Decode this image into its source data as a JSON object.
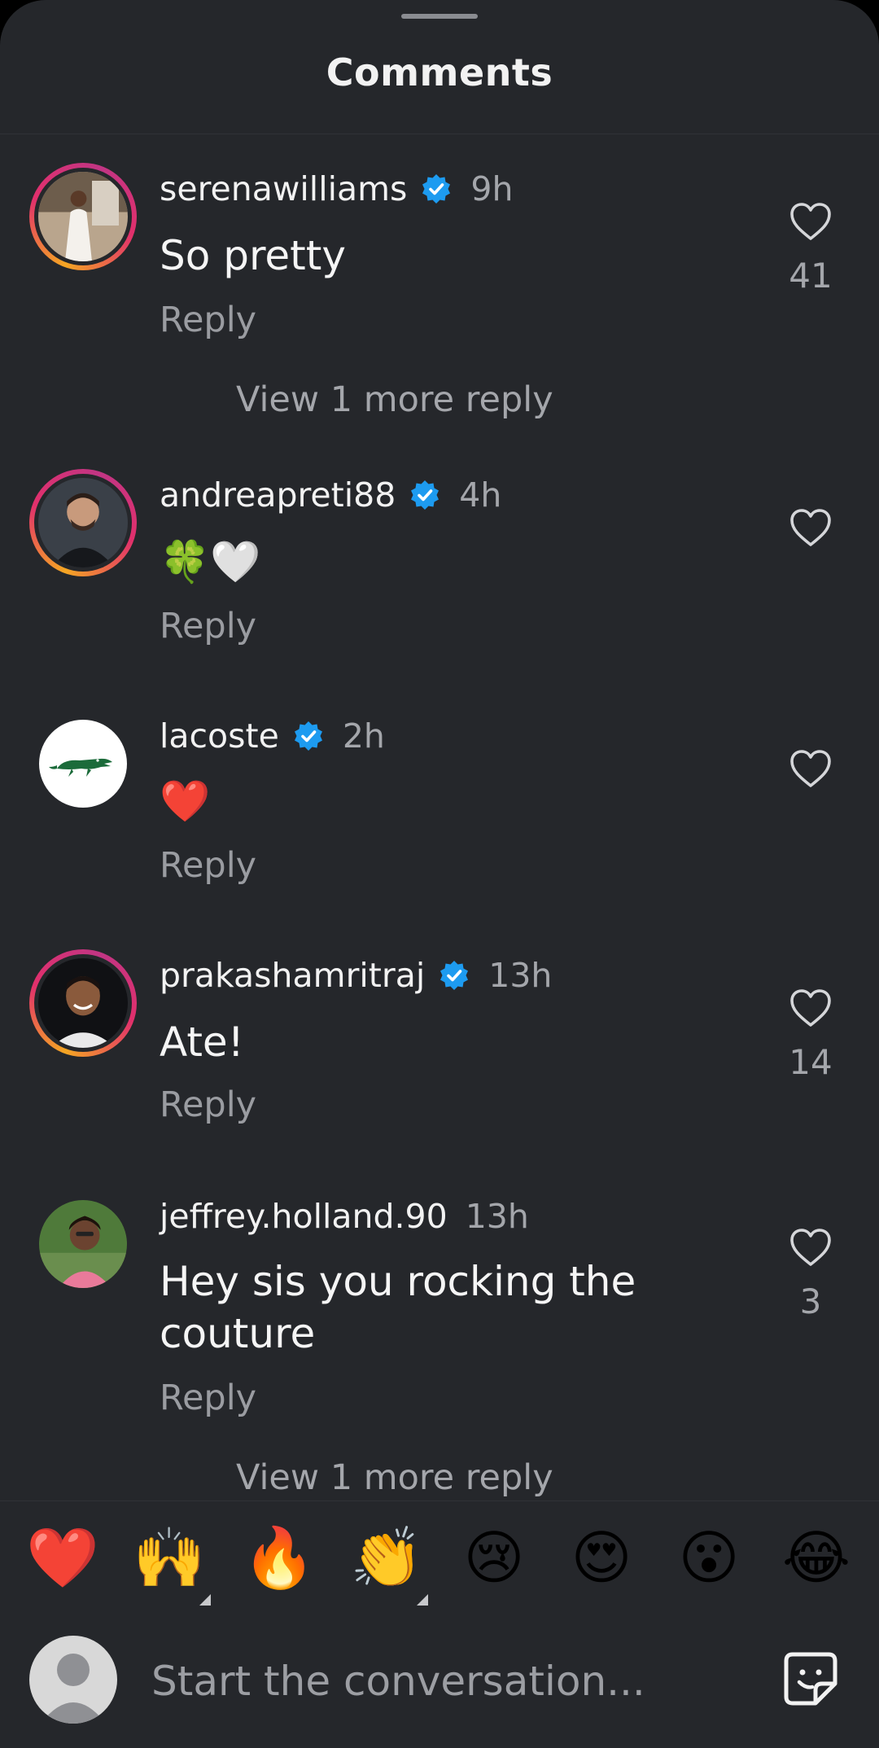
{
  "sheet": {
    "title": "Comments"
  },
  "comments": [
    {
      "username": "serenawilliams",
      "verified": true,
      "time": "9h",
      "text": "So pretty",
      "reply_label": "Reply",
      "likes": "41",
      "view_more": "View 1 more reply"
    },
    {
      "username": "andreapreti88",
      "verified": true,
      "time": "4h",
      "text": "🍀🤍",
      "reply_label": "Reply",
      "likes": ""
    },
    {
      "username": "lacoste",
      "verified": true,
      "time": "2h",
      "text": "❤️",
      "reply_label": "Reply",
      "likes": ""
    },
    {
      "username": "prakashamritraj",
      "verified": true,
      "time": "13h",
      "text": "Ate!",
      "reply_label": "Reply",
      "likes": "14"
    },
    {
      "username": "jeffrey.holland.90",
      "verified": false,
      "time": "13h",
      "text": "Hey sis you rocking the couture",
      "reply_label": "Reply",
      "likes": "3",
      "view_more": "View 1 more reply"
    }
  ],
  "emoji_bar": [
    "❤️",
    "🙌",
    "🔥",
    "👏",
    "😢",
    "😍",
    "😮",
    "😂"
  ],
  "compose": {
    "placeholder": "Start the conversation..."
  },
  "colors": {
    "background": "#25272b",
    "verified": "#1d9bf0",
    "muted_text": "#a4a6ab"
  }
}
